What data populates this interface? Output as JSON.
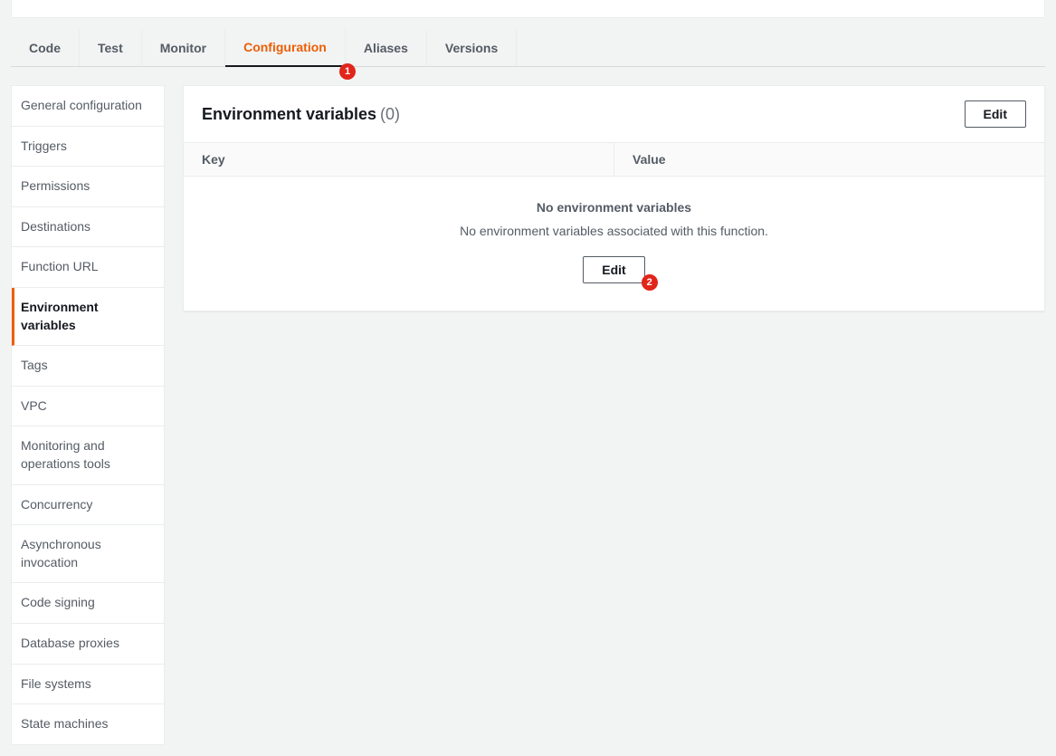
{
  "tabs": [
    {
      "label": "Code",
      "active": false
    },
    {
      "label": "Test",
      "active": false
    },
    {
      "label": "Monitor",
      "active": false
    },
    {
      "label": "Configuration",
      "active": true
    },
    {
      "label": "Aliases",
      "active": false
    },
    {
      "label": "Versions",
      "active": false
    }
  ],
  "callouts": {
    "one": "1",
    "two": "2"
  },
  "sidebar": {
    "items": [
      {
        "label": "General configuration",
        "active": false
      },
      {
        "label": "Triggers",
        "active": false
      },
      {
        "label": "Permissions",
        "active": false
      },
      {
        "label": "Destinations",
        "active": false
      },
      {
        "label": "Function URL",
        "active": false
      },
      {
        "label": "Environment variables",
        "active": true
      },
      {
        "label": "Tags",
        "active": false
      },
      {
        "label": "VPC",
        "active": false
      },
      {
        "label": "Monitoring and operations tools",
        "active": false
      },
      {
        "label": "Concurrency",
        "active": false
      },
      {
        "label": "Asynchronous invocation",
        "active": false
      },
      {
        "label": "Code signing",
        "active": false
      },
      {
        "label": "Database proxies",
        "active": false
      },
      {
        "label": "File systems",
        "active": false
      },
      {
        "label": "State machines",
        "active": false
      }
    ]
  },
  "panel": {
    "title": "Environment variables",
    "count": "(0)",
    "edit_label": "Edit",
    "columns": {
      "key": "Key",
      "value": "Value"
    },
    "empty": {
      "title": "No environment variables",
      "desc": "No environment variables associated with this function.",
      "button": "Edit"
    }
  }
}
